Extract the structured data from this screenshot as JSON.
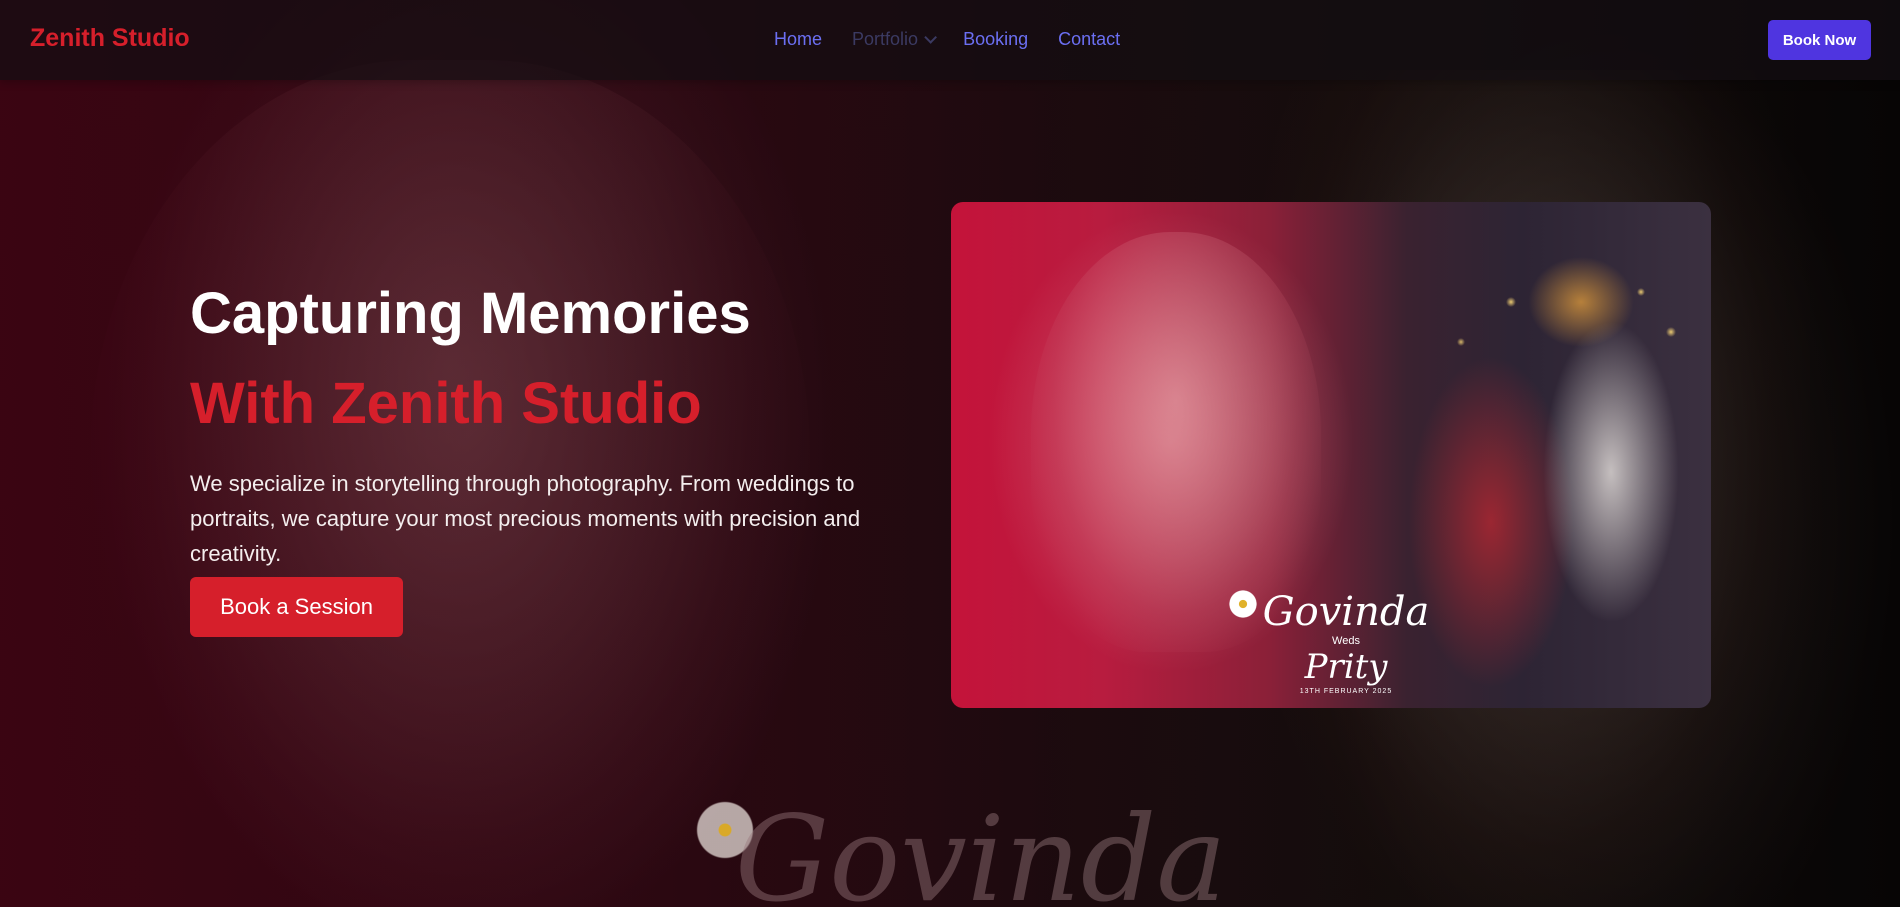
{
  "navbar": {
    "brand": "Zenith Studio",
    "links": [
      {
        "label": "Home"
      },
      {
        "label": "Portfolio"
      },
      {
        "label": "Booking"
      },
      {
        "label": "Contact"
      }
    ],
    "cta_label": "Book Now"
  },
  "hero": {
    "title": "Capturing Memories",
    "subtitle": "With Zenith Studio",
    "description": "We specialize in storytelling through photography. From weddings to portraits, we capture your most precious moments with precision and creativity.",
    "cta_label": "Book a Session"
  },
  "feature_image": {
    "groom_name": "Govinda",
    "weds": "Weds",
    "bride_name": "Prity",
    "date": "13TH FEBRUARY 2025"
  },
  "background": {
    "script_text": "Govinda"
  },
  "colors": {
    "brand": "#d61f2b",
    "nav_link": "#6b6ff2",
    "primary_button": "#4f35e0"
  },
  "icons": {
    "portfolio_dropdown": "chevron-down-icon"
  }
}
